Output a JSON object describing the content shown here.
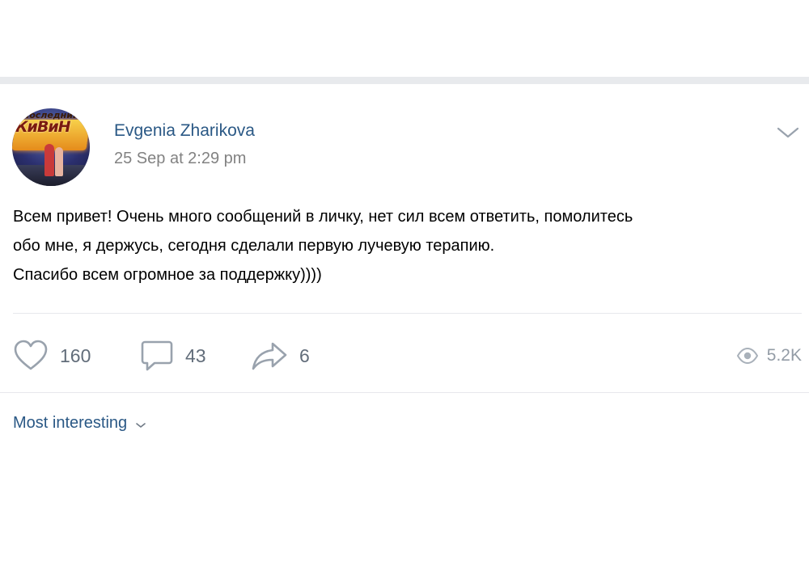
{
  "post": {
    "author": {
      "name": "Evgenia Zharikova",
      "avatar_text_top": "Последний",
      "avatar_text_main": "КиВиН"
    },
    "date": "25 Sep at 2:29 pm",
    "text_lines": [
      "Всем привет! Очень много сообщений в личку, нет сил всем ответить, помолитесь",
      "обо мне, я держусь, сегодня сделали первую лучевую терапию.",
      "Спасибо всем огромное за поддержку))))"
    ],
    "actions": {
      "likes": "160",
      "comments": "43",
      "shares": "6",
      "views": "5.2K"
    },
    "comments_sort": {
      "label": "Most interesting"
    }
  },
  "icons": {
    "menu": "chevron-down-icon",
    "like": "heart-icon",
    "comment": "comment-icon",
    "share": "share-arrow-icon",
    "views": "eye-icon",
    "sort": "chevron-down-icon"
  },
  "colors": {
    "link": "#2a5885",
    "meta": "#828282",
    "action_text": "#626d7a",
    "icon": "#99a2ad",
    "views_text": "#939ca6",
    "separator": "#e8eaed"
  }
}
